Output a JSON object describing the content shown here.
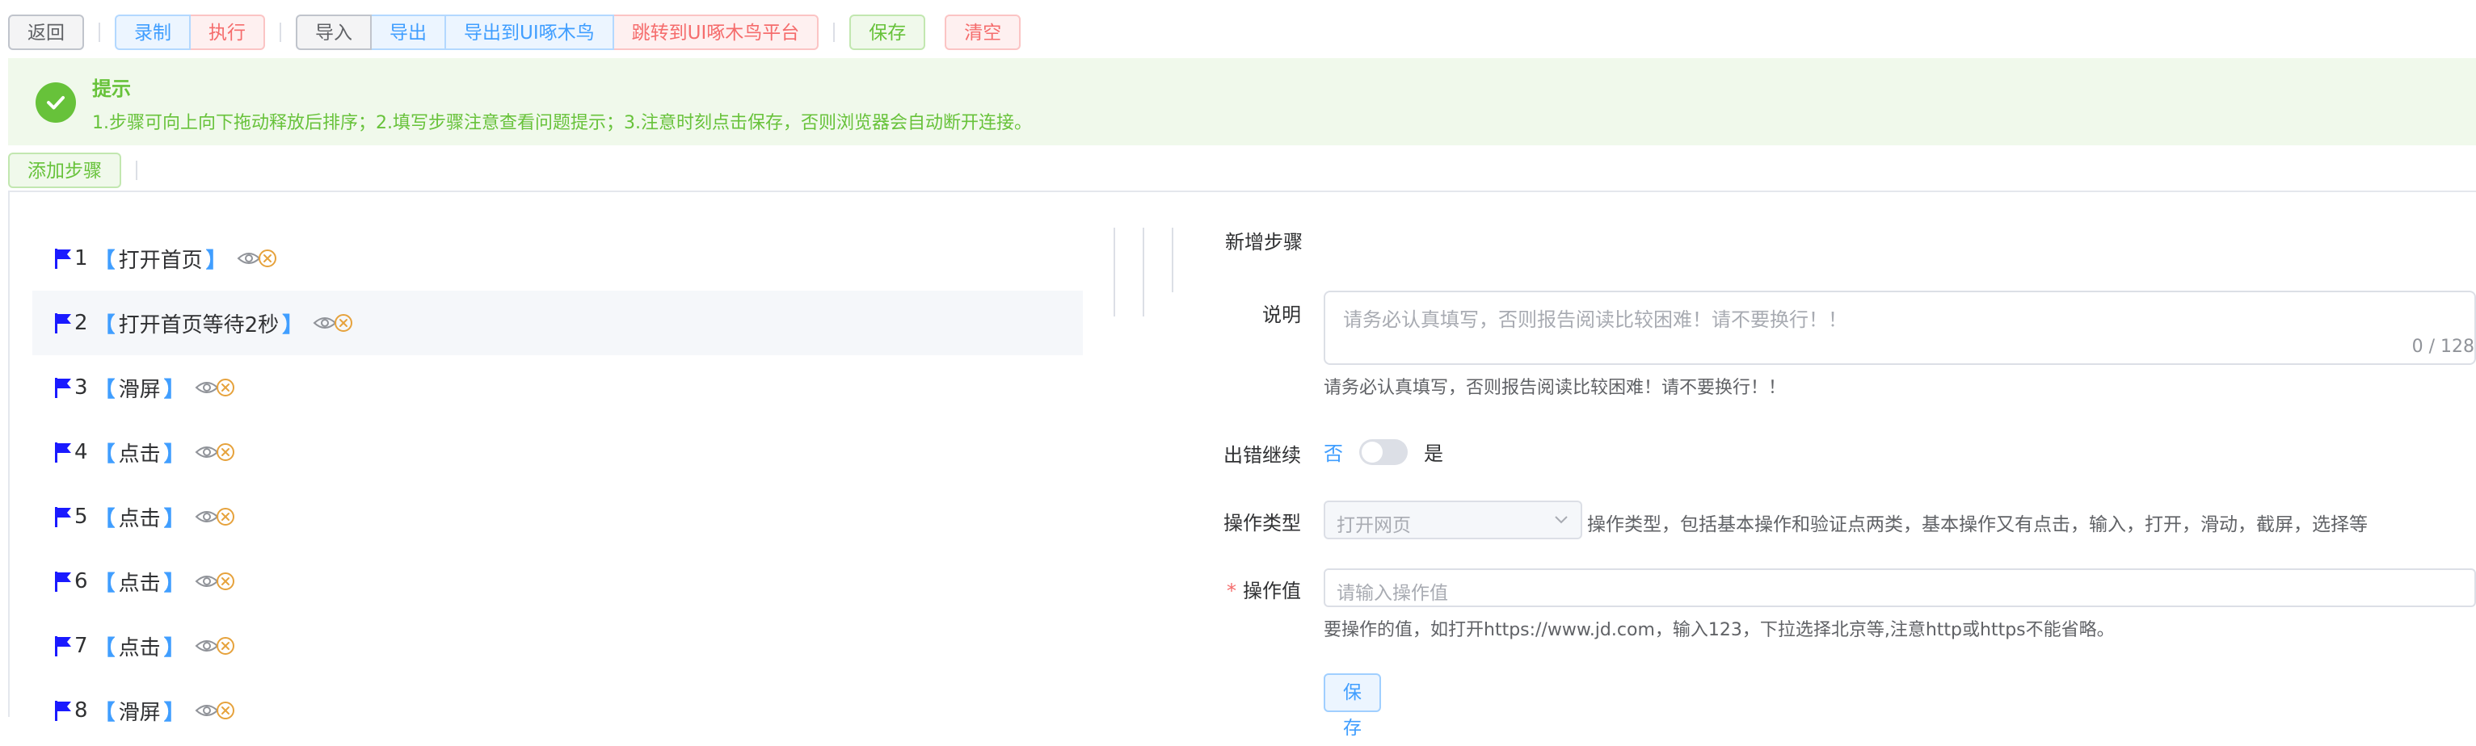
{
  "toolbar": {
    "back": "返回",
    "record": "录制",
    "execute": "执行",
    "import": "导入",
    "export": "导出",
    "export_ui": "导出到UI啄木鸟",
    "jump_ui": "跳转到UI啄木鸟平台",
    "save": "保存",
    "clear": "清空"
  },
  "alert": {
    "title": "提示",
    "desc": "1.步骤可向上向下拖动释放后排序；2.填写步骤注意查看问题提示；3.注意时刻点击保存，否则浏览器会自动断开连接。"
  },
  "add_step": "添加步骤",
  "steps": [
    {
      "num": "1",
      "name": "打开首页"
    },
    {
      "num": "2",
      "name": "打开首页等待2秒"
    },
    {
      "num": "3",
      "name": "滑屏"
    },
    {
      "num": "4",
      "name": "点击"
    },
    {
      "num": "5",
      "name": "点击"
    },
    {
      "num": "6",
      "name": "点击"
    },
    {
      "num": "7",
      "name": "点击"
    },
    {
      "num": "8",
      "name": "滑屏"
    }
  ],
  "bracket_open": "【",
  "bracket_close": "】",
  "form": {
    "heading": "新增步骤",
    "desc_label": "说明",
    "desc_placeholder": "请务必认真填写，否则报告阅读比较困难！请不要换行！！",
    "desc_counter": "0 / 128",
    "desc_hint": "请务必认真填写，否则报告阅读比较困难！请不要换行！！",
    "continue_label": "出错继续",
    "switch_off": "否",
    "switch_on": "是",
    "op_type_label": "操作类型",
    "op_type_value": "打开网页",
    "op_type_desc": "操作类型，包括基本操作和验证点两类，基本操作又有点击，输入，打开，滑动，截屏，选择等",
    "req_mark": "*",
    "op_value_label": "操作值",
    "op_value_placeholder": "请输入操作值",
    "op_value_hint": "要操作的值，如打开https://www.jd.com，输入123，下拉选择北京等,注意http或https不能省略。",
    "save": "保存"
  },
  "colors": {
    "primary": "#409eff",
    "success": "#67c23a",
    "danger": "#f56c6c",
    "flag": "#1a1aff",
    "icon_orange": "#e6a23c"
  }
}
